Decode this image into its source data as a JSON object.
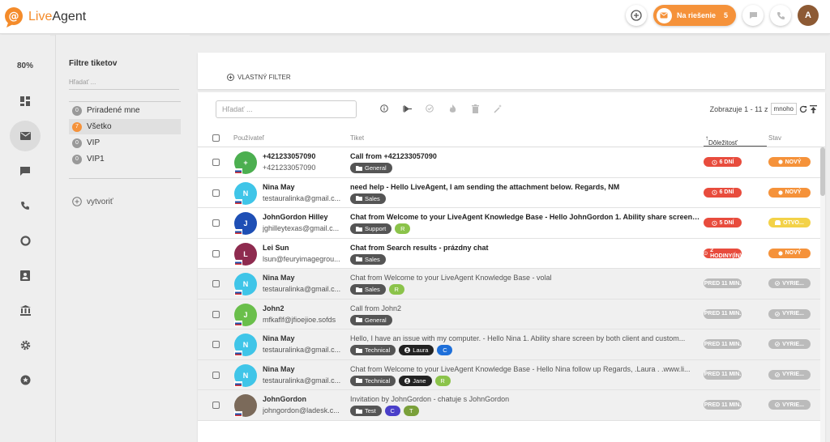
{
  "app": {
    "name_part1": "Live",
    "name_part2": "Agent"
  },
  "topbar": {
    "status_label": "Na riešenie",
    "status_count": "5",
    "avatar_letter": "A"
  },
  "nav": {
    "zoom": "80%"
  },
  "filters": {
    "title": "Filtre tiketov",
    "search_placeholder": "Hľadať ...",
    "items": [
      {
        "count": "0",
        "label": "Priradené mne"
      },
      {
        "count": "7",
        "label": "Všetko"
      },
      {
        "count": "0",
        "label": "VIP"
      },
      {
        "count": "0",
        "label": "VIP1"
      }
    ],
    "create_label": "vytvoriť"
  },
  "panel": {
    "custom_filter": "VLASTNÝ FILTER",
    "search_placeholder": "Hľadať ...",
    "pager_text": "Zobrazuje 1 - 11 z",
    "pager_select": "mnoho"
  },
  "table": {
    "headers": {
      "user": "Používateľ",
      "ticket": "Tiket",
      "priority": "Dôležitosť",
      "status": "Stav"
    },
    "rows": [
      {
        "avatar": "+",
        "avatar_color": "#4caf50",
        "name": "+421233057090",
        "email": "+421233057090",
        "subject": "Call from +421233057090",
        "tags": [
          {
            "label": "General",
            "icon": "folder"
          }
        ],
        "priority": "6 DNÍ",
        "status": "NOVÝ"
      },
      {
        "avatar": "N",
        "avatar_color": "#3fc5e8",
        "name": "Nina May",
        "email": "testauralinka@gmail.c...",
        "subject": "need help - Hello LiveAgent, I am sending the attachment below. Regards, NM",
        "tags": [
          {
            "label": "Sales",
            "icon": "folder"
          }
        ],
        "priority": "6 DNÍ",
        "status": "NOVÝ"
      },
      {
        "avatar": "J",
        "avatar_color": "#1e4fb5",
        "name": "JohnGordon Hilley",
        "email": "jghilleytexas@gmail.c...",
        "subject": "Chat from Welcome to your LiveAgent Knowledge Base - Hello JohnGordon 1. Ability share screen b...",
        "tags": [
          {
            "label": "Support",
            "icon": "folder"
          },
          {
            "label": "R",
            "icon": "",
            "color": "#8bc34a"
          }
        ],
        "priority": "5 DNÍ",
        "status": "OTVO..."
      },
      {
        "avatar": "L",
        "avatar_color": "#8e2b4f",
        "name": "Lei Sun",
        "email": "lsun@feuryimagegrou...",
        "subject": "Chat from Search results - prázdny chat",
        "tags": [
          {
            "label": "Sales",
            "icon": "folder"
          }
        ],
        "priority": "2 HODINY(ÍN)",
        "status": "NOVÝ"
      },
      {
        "avatar": "N",
        "avatar_color": "#3fc5e8",
        "name": "Nina May",
        "email": "testauralinka@gmail.c...",
        "subject": "Chat from Welcome to your LiveAgent Knowledge Base - volal",
        "tags": [
          {
            "label": "Sales",
            "icon": "folder"
          },
          {
            "label": "R",
            "icon": "",
            "color": "#8bc34a"
          }
        ],
        "priority": "PRED 11 MIN.",
        "status": "VYRIE..."
      },
      {
        "avatar": "J",
        "avatar_color": "#6abf4b",
        "name": "John2",
        "email": "mfkaflf@jfioejioe.sofds",
        "subject": "Call from John2",
        "tags": [
          {
            "label": "General",
            "icon": "folder"
          }
        ],
        "priority": "PRED 11 MIN.",
        "status": "VYRIE..."
      },
      {
        "avatar": "N",
        "avatar_color": "#3fc5e8",
        "name": "Nina May",
        "email": "testauralinka@gmail.c...",
        "subject": "Hello, I have an issue with my computer. - Hello Nina 1. Ability share screen by both client and custom...",
        "tags": [
          {
            "label": "Technical",
            "icon": "folder"
          },
          {
            "label": "Laura",
            "icon": "user",
            "dark": true
          },
          {
            "label": "C",
            "icon": "",
            "color": "#1e6fd9"
          }
        ],
        "priority": "PRED 11 MIN.",
        "status": "VYRIE..."
      },
      {
        "avatar": "N",
        "avatar_color": "#3fc5e8",
        "name": "Nina May",
        "email": "testauralinka@gmail.c...",
        "subject": "Chat from Welcome to your LiveAgent Knowledge Base - Hello Nina follow up Regards, .Laura . .www.li...",
        "tags": [
          {
            "label": "Technical",
            "icon": "folder"
          },
          {
            "label": "Jane",
            "icon": "user",
            "dark": true
          },
          {
            "label": "R",
            "icon": "",
            "color": "#8bc34a"
          }
        ],
        "priority": "PRED 11 MIN.",
        "status": "VYRIE..."
      },
      {
        "avatar": "",
        "avatar_color": "#7b6a5a",
        "name": "JohnGordon",
        "email": "johngordon@ladesk.c...",
        "subject": "Invitation by JohnGordon - chatuje s JohnGordon",
        "tags": [
          {
            "label": "Test",
            "icon": "folder"
          },
          {
            "label": "C",
            "icon": "",
            "color": "#4a3fc9"
          },
          {
            "label": "T",
            "icon": "",
            "color": "#7aa03a"
          }
        ],
        "priority": "PRED 11 MIN.",
        "status": "VYRIE..."
      }
    ]
  }
}
